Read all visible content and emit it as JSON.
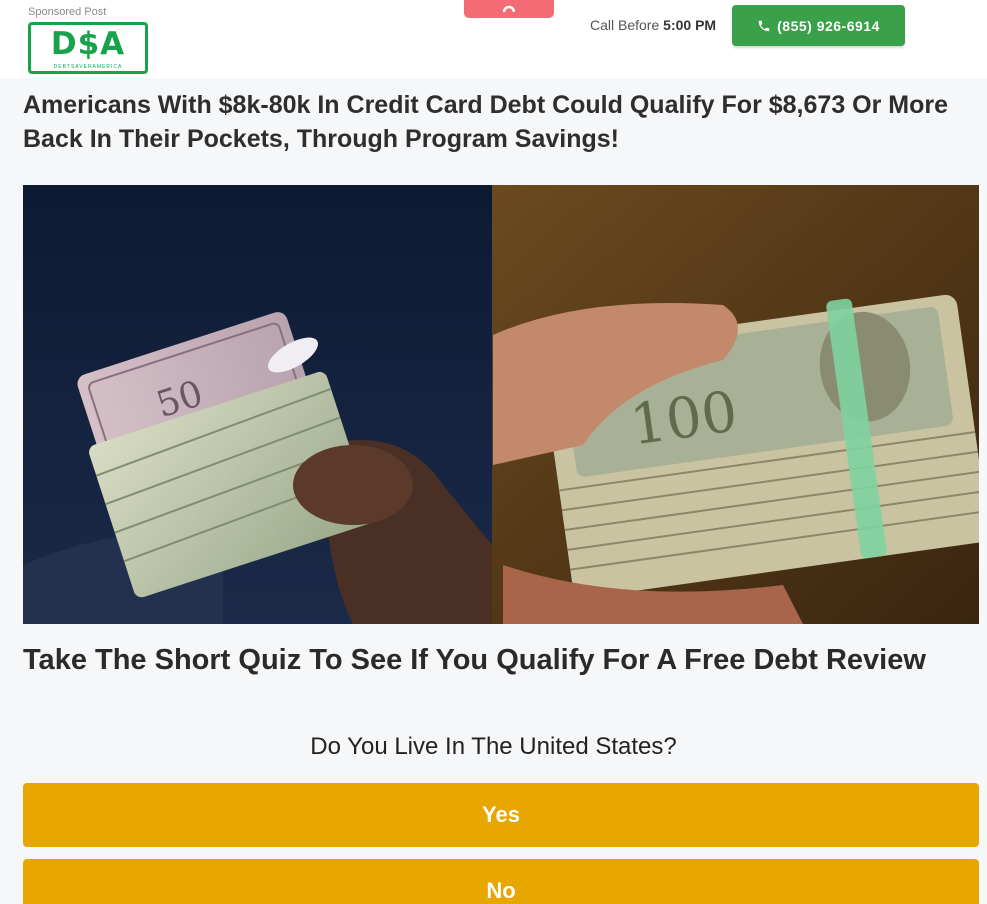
{
  "header": {
    "sponsored_label": "Sponsored Post",
    "logo_text": "D$A",
    "logo_subtext": "DEBTSAVERAMERICA",
    "call_prefix": "Call Before",
    "call_time": "5:00 PM",
    "phone_number": "(855) 926-6914"
  },
  "main": {
    "headline": "Americans With $8k-80k In Credit Card Debt Could Qualify For $8,673 Or More Back In Their Pockets, Through Program Savings!",
    "subheadline": "Take The Short Quiz To See If You Qualify For A Free Debt Review"
  },
  "quiz": {
    "question": "Do You Live In The United States?",
    "answers": [
      "Yes",
      "No"
    ]
  },
  "colors": {
    "brand_green": "#18a24a",
    "call_button": "#3aa04a",
    "answer_button": "#e8a600",
    "top_tab": "#f26b75"
  }
}
